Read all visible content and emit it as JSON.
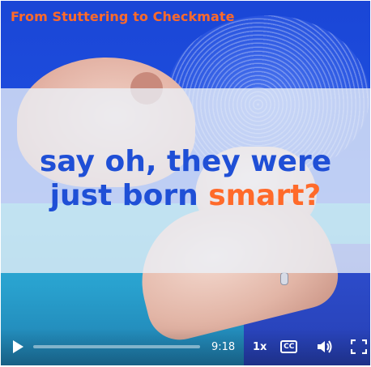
{
  "series_title": "From Stuttering to Checkmate",
  "caption": {
    "line1": "say  oh, they were",
    "line2_prefix": "just born ",
    "line2_accent": "smart?"
  },
  "controls": {
    "play_icon": "play-icon",
    "progress_fraction": 0.0,
    "time_remaining": "9:18",
    "playback_speed": "1x",
    "captions_label": "CC",
    "volume_icon": "volume-icon",
    "fullscreen_icon": "fullscreen-icon"
  },
  "colors": {
    "accent": "#ff6a2a",
    "caption_blue": "#1f4fd6",
    "background_blue": "#1f4fe0"
  }
}
